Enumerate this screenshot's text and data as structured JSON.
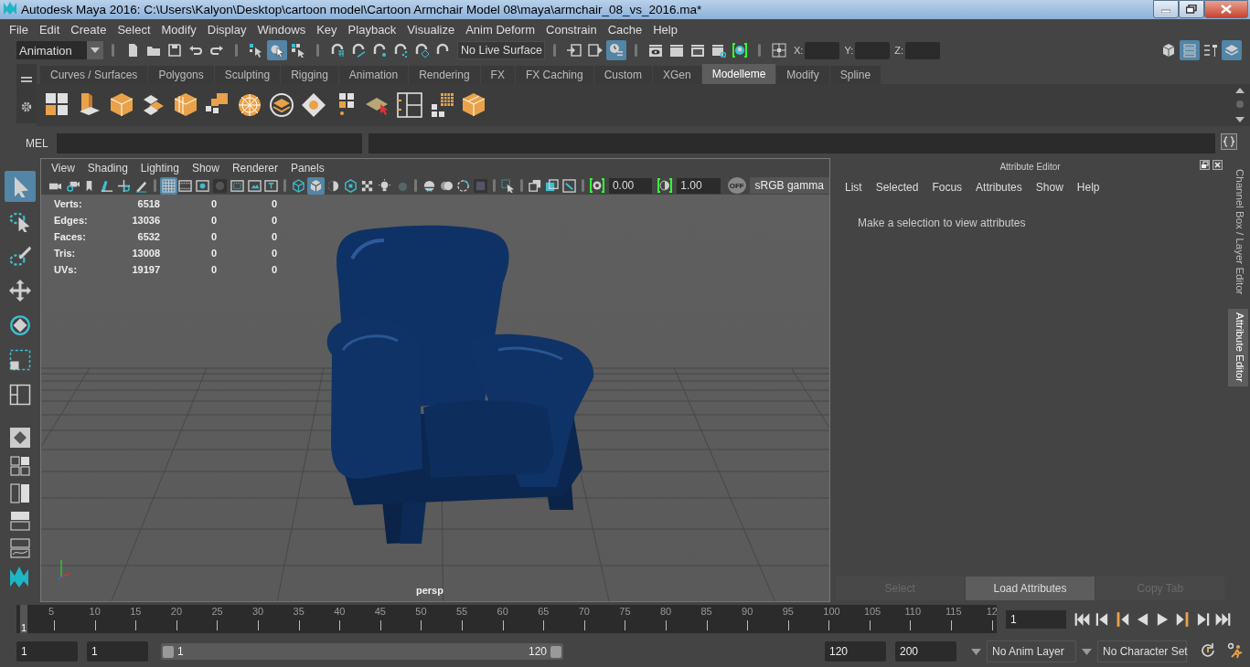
{
  "window": {
    "title": "Autodesk Maya 2016: C:\\Users\\Kalyon\\Desktop\\cartoon model\\Cartoon Armchair Model 08\\maya\\armchair_08_vs_2016.ma*"
  },
  "menu_bar": [
    "File",
    "Edit",
    "Create",
    "Select",
    "Modify",
    "Display",
    "Windows",
    "Key",
    "Playback",
    "Visualize",
    "Anim Deform",
    "Constrain",
    "Cache",
    "Help"
  ],
  "status_line": {
    "menu_set": "Animation",
    "tools": [
      {
        "selected": false
      },
      {
        "selected": false
      },
      {
        "selected": false
      },
      {
        "selected": false
      },
      {
        "selected": false
      },
      {
        "selected": false
      },
      {
        "selected": true
      },
      {
        "selected": false
      },
      {
        "selected": false
      },
      {
        "selected": false
      },
      {
        "selected": false
      },
      {
        "selected": false
      },
      {
        "selected": false
      },
      {
        "selected": false
      },
      {
        "selected": false
      },
      {
        "selected": false
      },
      {
        "selected": true
      },
      {
        "selected": false
      },
      {
        "selected": false
      },
      {
        "selected": false
      },
      {
        "selected": false
      },
      {
        "selected": false
      },
      {
        "selected": false
      }
    ],
    "live_surface": "No Live Surface",
    "coordinates": [
      "X:",
      "Y:",
      "Z:"
    ],
    "panel_toggles": [
      {
        "selected": false
      },
      {
        "selected": true
      },
      {
        "selected": false
      },
      {
        "selected": true
      }
    ]
  },
  "shelf_tabs": [
    {
      "label": "Curves / Surfaces",
      "selected": false
    },
    {
      "label": "Polygons",
      "selected": false
    },
    {
      "label": "Sculpting",
      "selected": false
    },
    {
      "label": "Rigging",
      "selected": false
    },
    {
      "label": "Animation",
      "selected": false
    },
    {
      "label": "Rendering",
      "selected": false
    },
    {
      "label": "FX",
      "selected": false
    },
    {
      "label": "FX Caching",
      "selected": false
    },
    {
      "label": "Custom",
      "selected": false
    },
    {
      "label": "XGen",
      "selected": false
    },
    {
      "label": "Modelleme",
      "selected": true
    },
    {
      "label": "Modify",
      "selected": false
    },
    {
      "label": "Spline",
      "selected": false
    }
  ],
  "command_line": {
    "label": "MEL"
  },
  "toolbox": [
    {
      "selected": true
    },
    {
      "selected": false
    },
    {
      "selected": false
    },
    {
      "selected": false
    },
    {
      "selected": false
    },
    {
      "selected": false
    },
    {
      "selected": false
    }
  ],
  "viewport": {
    "menus": [
      "View",
      "Shading",
      "Lighting",
      "Show",
      "Renderer",
      "Panels"
    ],
    "toolbar": [
      {
        "selected": false
      },
      {
        "selected": false
      },
      {
        "selected": false
      },
      {
        "selected": false
      },
      {
        "selected": false
      },
      {
        "selected": false
      },
      {
        "selected": true
      },
      {
        "selected": false
      },
      {
        "selected": false
      },
      {
        "selected": false
      },
      {
        "selected": false
      },
      {
        "selected": false
      },
      {
        "selected": false
      },
      {
        "selected": false
      },
      {
        "selected": true
      },
      {
        "selected": false
      },
      {
        "selected": false
      },
      {
        "selected": false
      },
      {
        "selected": false
      },
      {
        "selected": false
      },
      {
        "selected": false
      },
      {
        "selected": false
      },
      {
        "selected": false
      },
      {
        "selected": false
      },
      {
        "selected": false
      },
      {
        "selected": false
      },
      {
        "selected": false
      },
      {
        "selected": false
      }
    ],
    "exposure": "0.00",
    "gamma": "1.00",
    "view_transform_toggle": "OFF",
    "color_space": "sRGB gamma",
    "hud_rows": [
      {
        "label": "Verts:",
        "values": [
          "6518",
          "0",
          "0"
        ]
      },
      {
        "label": "Edges:",
        "values": [
          "13036",
          "0",
          "0"
        ]
      },
      {
        "label": "Faces:",
        "values": [
          "6532",
          "0",
          "0"
        ]
      },
      {
        "label": "Tris:",
        "values": [
          "13008",
          "0",
          "0"
        ]
      },
      {
        "label": "UVs:",
        "values": [
          "19197",
          "0",
          "0"
        ]
      }
    ],
    "camera": "persp"
  },
  "attribute_editor": {
    "title": "Attribute Editor",
    "menus": [
      "List",
      "Selected",
      "Focus",
      "Attributes",
      "Show",
      "Help"
    ],
    "message": "Make a selection to view attributes",
    "buttons": [
      {
        "label": "Select",
        "disabled": true
      },
      {
        "label": "Load Attributes",
        "disabled": false
      },
      {
        "label": "Copy Tab",
        "disabled": true
      }
    ]
  },
  "side_tabs": [
    {
      "label": "Channel Box / Layer Editor",
      "selected": false
    },
    {
      "label": "Attribute Editor",
      "selected": true
    }
  ],
  "time_slider": {
    "current_marker": "1",
    "level": 0,
    "ticks": [
      "5",
      "10",
      "15",
      "20",
      "25",
      "30",
      "35",
      "40",
      "45",
      "50",
      "55",
      "60",
      "65",
      "70",
      "75",
      "80",
      "85",
      "90",
      "95",
      "100",
      "105",
      "110",
      "115",
      "12"
    ],
    "current_frame": "1"
  },
  "range_slider": {
    "animation_start": "1",
    "playback_start": "1",
    "range_start": "1",
    "range_end": "120",
    "level": 1,
    "playback_end": "120",
    "animation_end": "200",
    "anim_layer": "No Anim Layer",
    "character_set": "No Character Set"
  }
}
